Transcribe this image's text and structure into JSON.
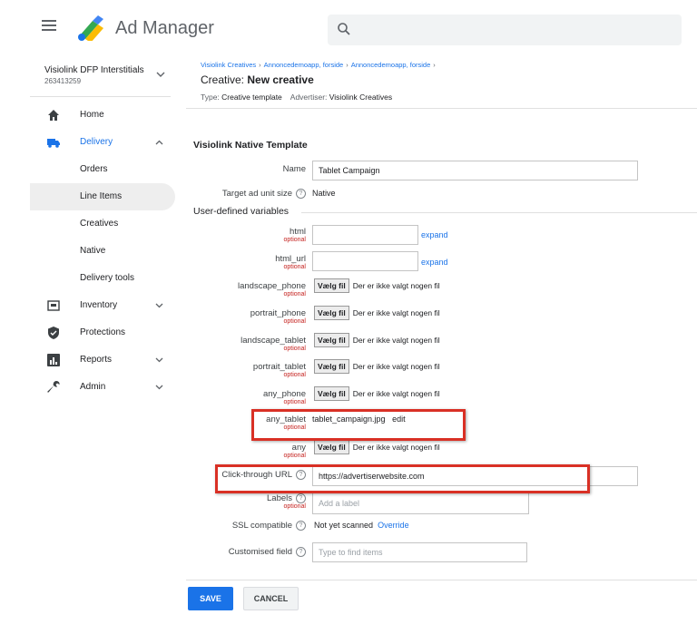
{
  "header": {
    "app_title": "Ad Manager",
    "search_placeholder": ""
  },
  "network": {
    "name": "Visiolink DFP Interstitials",
    "id": "263413259"
  },
  "sidebar": {
    "items": [
      {
        "label": "Home"
      },
      {
        "label": "Delivery"
      },
      {
        "label": "Orders"
      },
      {
        "label": "Line Items"
      },
      {
        "label": "Creatives"
      },
      {
        "label": "Native"
      },
      {
        "label": "Delivery tools"
      },
      {
        "label": "Inventory"
      },
      {
        "label": "Protections"
      },
      {
        "label": "Reports"
      },
      {
        "label": "Admin"
      }
    ]
  },
  "breadcrumb": [
    "Visiolink Creatives",
    "Annoncedemoapp, forside",
    "Annoncedemoapp, forside"
  ],
  "title": {
    "prefix": "Creative:",
    "name": "New creative"
  },
  "subline": {
    "type_label": "Type:",
    "type_value": "Creative template",
    "advertiser_label": "Advertiser:",
    "advertiser_value": "Visiolink Creatives"
  },
  "section_title": "Visiolink Native Template",
  "fields": {
    "name_label": "Name",
    "name_value": "Tablet Campaign",
    "size_label": "Target ad unit size",
    "size_value": "Native",
    "udv_title": "User-defined variables",
    "optional": "optional",
    "expand": "expand",
    "html_label": "html",
    "html_url_label": "html_url",
    "file_button": "Vælg fil",
    "no_file": "Der er ikke valgt nogen fil",
    "landscape_phone": "landscape_phone",
    "portrait_phone": "portrait_phone",
    "landscape_tablet": "landscape_tablet",
    "portrait_tablet": "portrait_tablet",
    "any_phone": "any_phone",
    "any_tablet": "any_tablet",
    "any_tablet_file": "tablet_campaign.jpg",
    "edit": "edit",
    "any": "any",
    "click_label": "Click-through URL",
    "click_value": "https://advertiserwebsite.com",
    "labels_label": "Labels",
    "labels_placeholder": "Add a label",
    "ssl_label": "SSL compatible",
    "ssl_value": "Not yet scanned",
    "override": "Override",
    "custom_label": "Customised field",
    "custom_placeholder": "Type to find items"
  },
  "actions": {
    "save": "SAVE",
    "cancel": "CANCEL"
  },
  "colors": {
    "accent": "#1a73e8",
    "highlight": "#d93025",
    "optional": "#c5221f"
  }
}
